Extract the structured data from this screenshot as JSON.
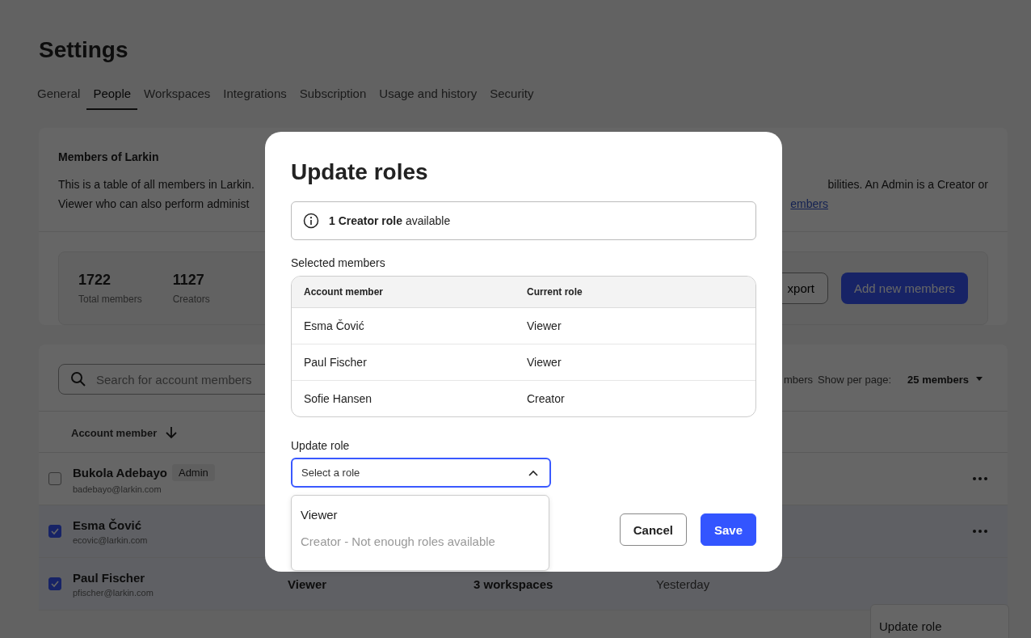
{
  "page": {
    "title": "Settings"
  },
  "tabs": [
    {
      "label": "General",
      "selected": false
    },
    {
      "label": "People",
      "selected": true
    },
    {
      "label": "Workspaces",
      "selected": false
    },
    {
      "label": "Integrations",
      "selected": false
    },
    {
      "label": "Subscription",
      "selected": false
    },
    {
      "label": "Usage and history",
      "selected": false
    },
    {
      "label": "Security",
      "selected": false
    }
  ],
  "members_card": {
    "heading": "Members of Larkin",
    "line_1_left": "This is a table of all members in Larkin.",
    "line_1_right": "bilities. An Admin is a Creator or",
    "line_2_left": "Viewer who can also perform administ",
    "link": "embers",
    "stats": [
      {
        "value": "1722",
        "label": "Total members"
      },
      {
        "value": "1127",
        "label": "Creators"
      }
    ],
    "export_button": "xport",
    "add_button": "Add new members"
  },
  "table_card": {
    "search": {
      "placeholder": "Search for account members"
    },
    "count_text": "mbers",
    "per_page_label": "Show per page:",
    "per_page_value": "25 members",
    "sort_column": "Account member",
    "rows": [
      {
        "name": "Bukola Adebayo",
        "badge": "Admin",
        "email": "badebayo@larkin.com",
        "checked": false,
        "role": "",
        "workspaces": "",
        "last_active": "",
        "menu": true
      },
      {
        "name": "Esma Čović",
        "badge": "",
        "email": "ecovic@larkin.com",
        "checked": true,
        "role": "",
        "workspaces": "",
        "last_active": "",
        "menu": true
      },
      {
        "name": "Paul Fischer",
        "badge": "",
        "email": "pfischer@larkin.com",
        "checked": true,
        "role": "Viewer",
        "workspaces": "3 workspaces",
        "last_active": "Yesterday",
        "menu": false
      }
    ],
    "context_menu": {
      "items": [
        "Update role"
      ]
    }
  },
  "modal": {
    "title": "Update roles",
    "info": "**1 Creator role** available",
    "selected_label": "Selected members",
    "columns": [
      "Account member",
      "Current role"
    ],
    "members": [
      {
        "name": "Esma Čović",
        "role": "Viewer"
      },
      {
        "name": "Paul Fischer",
        "role": "Viewer"
      },
      {
        "name": "Sofie Hansen",
        "role": "Creator"
      }
    ],
    "role_label": "Update role",
    "role_select": {
      "placeholder": "Select a role",
      "expanded": true
    },
    "options": [
      {
        "label": "Viewer",
        "disabled": false
      },
      {
        "label": "Creator - Not enough roles available",
        "disabled": true
      }
    ],
    "buttons": [
      {
        "label": "Cancel",
        "kind": "secondary"
      },
      {
        "label": "Save",
        "kind": "primary"
      }
    ]
  }
}
